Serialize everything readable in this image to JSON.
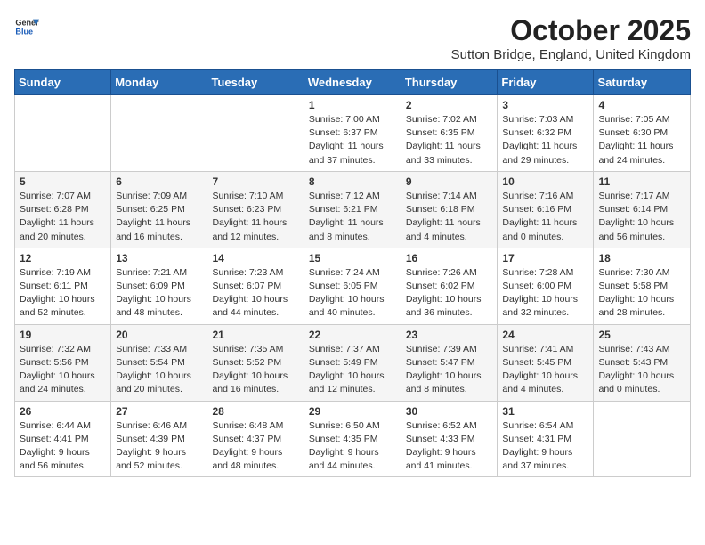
{
  "header": {
    "logo_line1": "General",
    "logo_line2": "Blue",
    "month": "October 2025",
    "location": "Sutton Bridge, England, United Kingdom"
  },
  "weekdays": [
    "Sunday",
    "Monday",
    "Tuesday",
    "Wednesday",
    "Thursday",
    "Friday",
    "Saturday"
  ],
  "weeks": [
    [
      {
        "day": "",
        "info": ""
      },
      {
        "day": "",
        "info": ""
      },
      {
        "day": "",
        "info": ""
      },
      {
        "day": "1",
        "info": "Sunrise: 7:00 AM\nSunset: 6:37 PM\nDaylight: 11 hours\nand 37 minutes."
      },
      {
        "day": "2",
        "info": "Sunrise: 7:02 AM\nSunset: 6:35 PM\nDaylight: 11 hours\nand 33 minutes."
      },
      {
        "day": "3",
        "info": "Sunrise: 7:03 AM\nSunset: 6:32 PM\nDaylight: 11 hours\nand 29 minutes."
      },
      {
        "day": "4",
        "info": "Sunrise: 7:05 AM\nSunset: 6:30 PM\nDaylight: 11 hours\nand 24 minutes."
      }
    ],
    [
      {
        "day": "5",
        "info": "Sunrise: 7:07 AM\nSunset: 6:28 PM\nDaylight: 11 hours\nand 20 minutes."
      },
      {
        "day": "6",
        "info": "Sunrise: 7:09 AM\nSunset: 6:25 PM\nDaylight: 11 hours\nand 16 minutes."
      },
      {
        "day": "7",
        "info": "Sunrise: 7:10 AM\nSunset: 6:23 PM\nDaylight: 11 hours\nand 12 minutes."
      },
      {
        "day": "8",
        "info": "Sunrise: 7:12 AM\nSunset: 6:21 PM\nDaylight: 11 hours\nand 8 minutes."
      },
      {
        "day": "9",
        "info": "Sunrise: 7:14 AM\nSunset: 6:18 PM\nDaylight: 11 hours\nand 4 minutes."
      },
      {
        "day": "10",
        "info": "Sunrise: 7:16 AM\nSunset: 6:16 PM\nDaylight: 11 hours\nand 0 minutes."
      },
      {
        "day": "11",
        "info": "Sunrise: 7:17 AM\nSunset: 6:14 PM\nDaylight: 10 hours\nand 56 minutes."
      }
    ],
    [
      {
        "day": "12",
        "info": "Sunrise: 7:19 AM\nSunset: 6:11 PM\nDaylight: 10 hours\nand 52 minutes."
      },
      {
        "day": "13",
        "info": "Sunrise: 7:21 AM\nSunset: 6:09 PM\nDaylight: 10 hours\nand 48 minutes."
      },
      {
        "day": "14",
        "info": "Sunrise: 7:23 AM\nSunset: 6:07 PM\nDaylight: 10 hours\nand 44 minutes."
      },
      {
        "day": "15",
        "info": "Sunrise: 7:24 AM\nSunset: 6:05 PM\nDaylight: 10 hours\nand 40 minutes."
      },
      {
        "day": "16",
        "info": "Sunrise: 7:26 AM\nSunset: 6:02 PM\nDaylight: 10 hours\nand 36 minutes."
      },
      {
        "day": "17",
        "info": "Sunrise: 7:28 AM\nSunset: 6:00 PM\nDaylight: 10 hours\nand 32 minutes."
      },
      {
        "day": "18",
        "info": "Sunrise: 7:30 AM\nSunset: 5:58 PM\nDaylight: 10 hours\nand 28 minutes."
      }
    ],
    [
      {
        "day": "19",
        "info": "Sunrise: 7:32 AM\nSunset: 5:56 PM\nDaylight: 10 hours\nand 24 minutes."
      },
      {
        "day": "20",
        "info": "Sunrise: 7:33 AM\nSunset: 5:54 PM\nDaylight: 10 hours\nand 20 minutes."
      },
      {
        "day": "21",
        "info": "Sunrise: 7:35 AM\nSunset: 5:52 PM\nDaylight: 10 hours\nand 16 minutes."
      },
      {
        "day": "22",
        "info": "Sunrise: 7:37 AM\nSunset: 5:49 PM\nDaylight: 10 hours\nand 12 minutes."
      },
      {
        "day": "23",
        "info": "Sunrise: 7:39 AM\nSunset: 5:47 PM\nDaylight: 10 hours\nand 8 minutes."
      },
      {
        "day": "24",
        "info": "Sunrise: 7:41 AM\nSunset: 5:45 PM\nDaylight: 10 hours\nand 4 minutes."
      },
      {
        "day": "25",
        "info": "Sunrise: 7:43 AM\nSunset: 5:43 PM\nDaylight: 10 hours\nand 0 minutes."
      }
    ],
    [
      {
        "day": "26",
        "info": "Sunrise: 6:44 AM\nSunset: 4:41 PM\nDaylight: 9 hours\nand 56 minutes."
      },
      {
        "day": "27",
        "info": "Sunrise: 6:46 AM\nSunset: 4:39 PM\nDaylight: 9 hours\nand 52 minutes."
      },
      {
        "day": "28",
        "info": "Sunrise: 6:48 AM\nSunset: 4:37 PM\nDaylight: 9 hours\nand 48 minutes."
      },
      {
        "day": "29",
        "info": "Sunrise: 6:50 AM\nSunset: 4:35 PM\nDaylight: 9 hours\nand 44 minutes."
      },
      {
        "day": "30",
        "info": "Sunrise: 6:52 AM\nSunset: 4:33 PM\nDaylight: 9 hours\nand 41 minutes."
      },
      {
        "day": "31",
        "info": "Sunrise: 6:54 AM\nSunset: 4:31 PM\nDaylight: 9 hours\nand 37 minutes."
      },
      {
        "day": "",
        "info": ""
      }
    ]
  ]
}
